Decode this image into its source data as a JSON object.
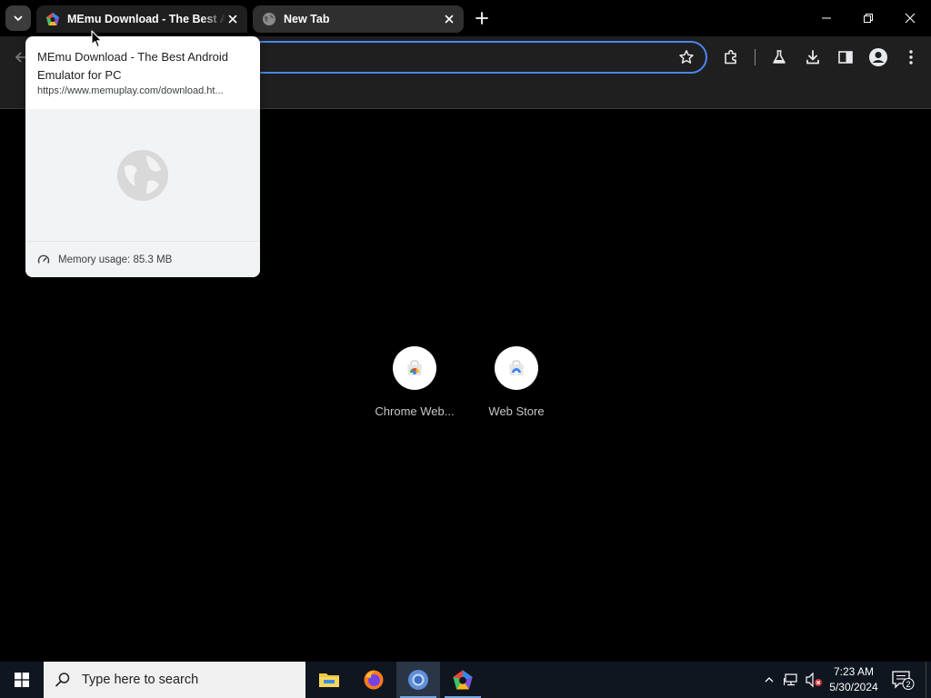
{
  "tabs": [
    {
      "title": "MEmu Download - The Best Android Emulator for PC",
      "active": true,
      "favicon": "memu-logo-icon"
    },
    {
      "title": "New Tab",
      "active": false,
      "favicon": "globe-icon"
    }
  ],
  "window_controls": [
    "minimize",
    "restore",
    "close"
  ],
  "toolbar": {
    "icons": [
      "extensions-icon",
      "labs-icon",
      "download-icon",
      "side-panel-icon",
      "profile-icon",
      "menu-icon"
    ]
  },
  "hover_card": {
    "title": "MEmu Download - The Best Android Emulator for PC",
    "url": "https://www.memuplay.com/download.ht...",
    "memory": "Memory usage: 85.3 MB"
  },
  "shortcuts": [
    {
      "label": "Chrome Web..."
    },
    {
      "label": "Web Store"
    }
  ],
  "taskbar": {
    "search_placeholder": "Type here to search",
    "apps": [
      "file-explorer",
      "firefox",
      "chrome",
      "memu"
    ],
    "time": "7:23 AM",
    "date": "5/30/2024",
    "notification_count": "2"
  },
  "colors": {
    "accent": "#4b86f0",
    "tab_active_bg": "#1f1f1f",
    "taskbar_bg": "#101620"
  }
}
